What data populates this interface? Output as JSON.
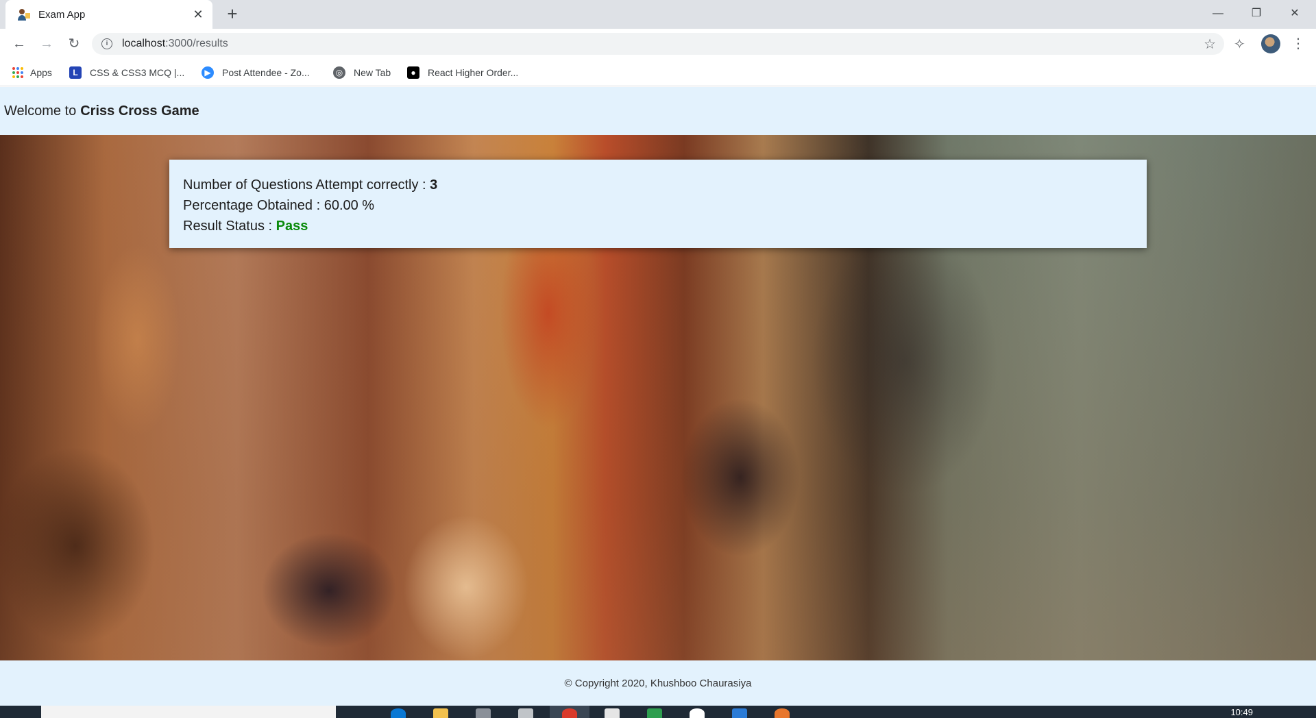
{
  "browser": {
    "tab_title": "Exam App",
    "tab_close": "✕",
    "new_tab": "+",
    "url_host": "localhost",
    "url_path": ":3000/results",
    "bookmarks": [
      {
        "label": "Apps",
        "icon": "apps-grid-icon"
      },
      {
        "label": "CSS & CSS3 MCQ |...",
        "icon": "l-logo-icon",
        "color": "#2444b5"
      },
      {
        "label": "Post Attendee - Zo...",
        "icon": "zoom-icon",
        "color": "#2d8cff"
      },
      {
        "label": "New Tab",
        "icon": "globe-icon",
        "color": "#5f6368"
      },
      {
        "label": "React Higher Order...",
        "icon": "medium-icon",
        "color": "#000000"
      }
    ]
  },
  "header": {
    "prefix": "Welcome to",
    "app_name": "Criss Cross Game"
  },
  "results": {
    "questions_label": "Number of Questions Attempt correctly :",
    "questions_value": "3",
    "percentage_label": "Percentage Obtained : 60.00 %",
    "status_label": "Result Status :",
    "status_value": "Pass",
    "status_color": "#0a8a0a"
  },
  "footer": {
    "copyright": "© Copyright 2020, Khushboo Chaurasiya"
  },
  "taskbar": {
    "time": "10:49"
  }
}
